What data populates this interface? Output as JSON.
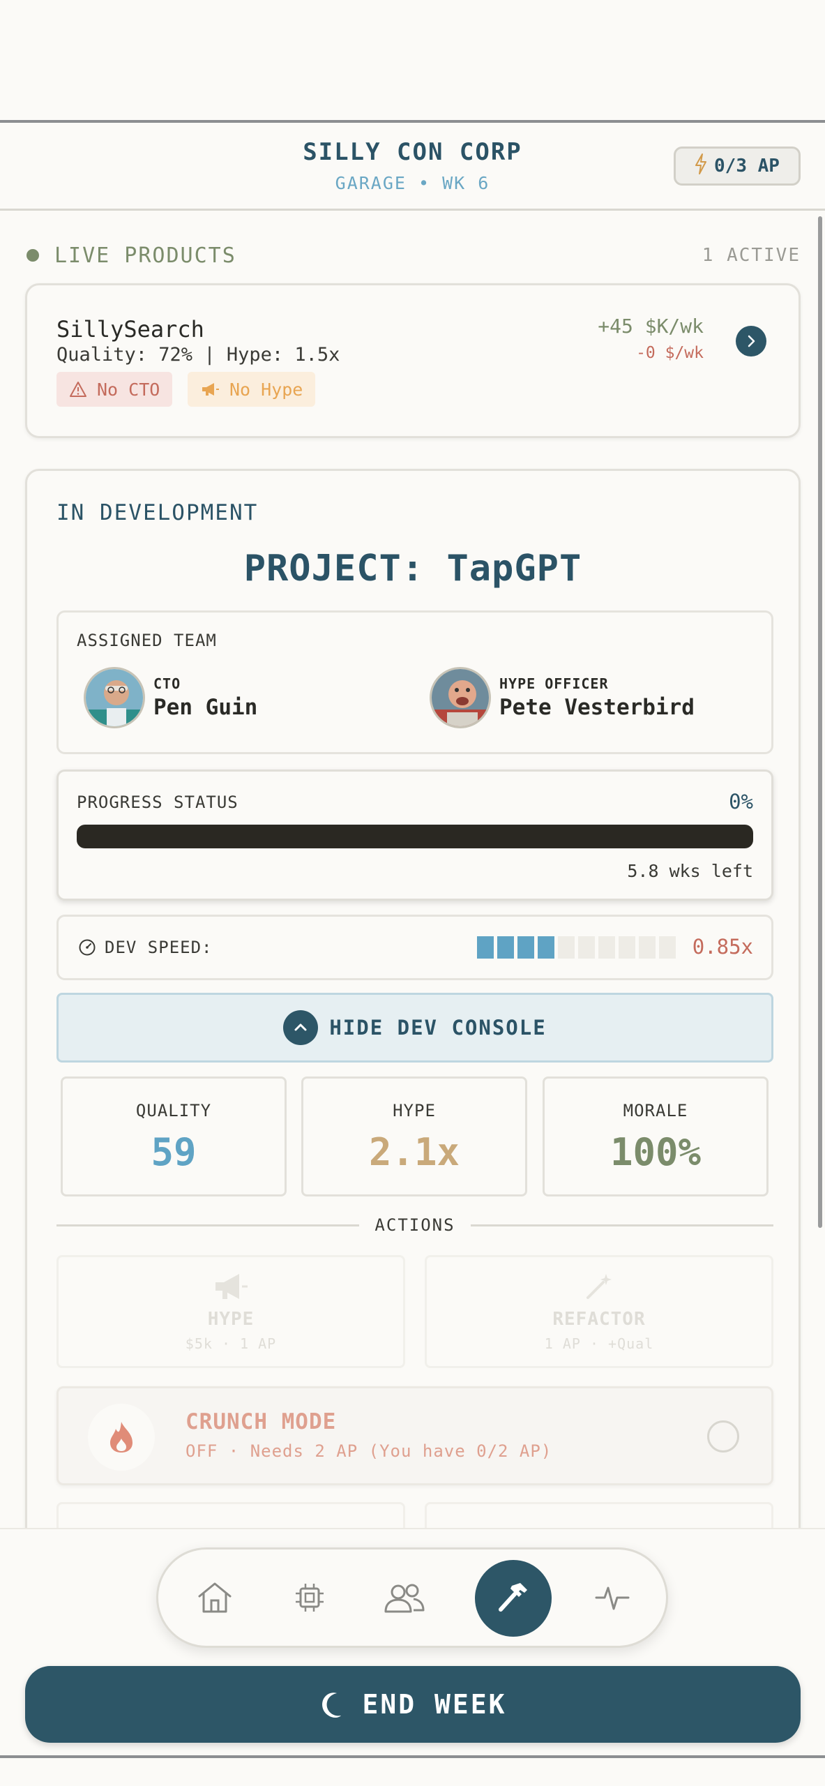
{
  "header": {
    "title": "SILLY CON CORP",
    "subtitle": "GARAGE • WK 6",
    "ap": "0/3 AP"
  },
  "live": {
    "label": "LIVE PRODUCTS",
    "count": "1 ACTIVE",
    "product": {
      "name": "SillySearch",
      "meta": "Quality: 72% | Hype: 1.5x",
      "income": "+45 $K/wk",
      "cost": "-0 $/wk",
      "tags": [
        "No CTO",
        "No Hype"
      ]
    }
  },
  "dev": {
    "label": "IN DEVELOPMENT",
    "project_title": "PROJECT: TapGPT",
    "team": {
      "caption": "ASSIGNED TEAM",
      "members": [
        {
          "role": "CTO",
          "name": "Pen Guin"
        },
        {
          "role": "HYPE OFFICER",
          "name": "Pete Vesterbird"
        }
      ]
    },
    "progress": {
      "caption": "PROGRESS STATUS",
      "percent_label": "0%",
      "percent": 0,
      "time_left": "5.8 wks left"
    },
    "speed": {
      "caption": "DEV SPEED:",
      "value": "0.85x",
      "segments_on": 4,
      "segments_total": 10
    },
    "console_button": "HIDE DEV CONSOLE",
    "stats": [
      {
        "label": "QUALITY",
        "value": "59",
        "color": "#5fa3c4"
      },
      {
        "label": "HYPE",
        "value": "2.1x",
        "color": "#c9a97a"
      },
      {
        "label": "MORALE",
        "value": "100%",
        "color": "#7b8c6b"
      }
    ],
    "actions_label": "ACTIONS",
    "actions": [
      {
        "name": "HYPE",
        "sub": "$5k · 1 AP",
        "icon": "megaphone-icon"
      },
      {
        "name": "REFACTOR",
        "sub": "1 AP · +Qual",
        "icon": "magic-wand-icon"
      }
    ],
    "crunch": {
      "title": "CRUNCH MODE",
      "sub": "OFF · Needs 2 AP (You have 0/2 AP)"
    }
  },
  "nav": {
    "items": [
      "home-icon",
      "chip-icon",
      "team-icon",
      "hammer-icon",
      "pulse-icon"
    ],
    "active": 3
  },
  "end_week": "END WEEK"
}
